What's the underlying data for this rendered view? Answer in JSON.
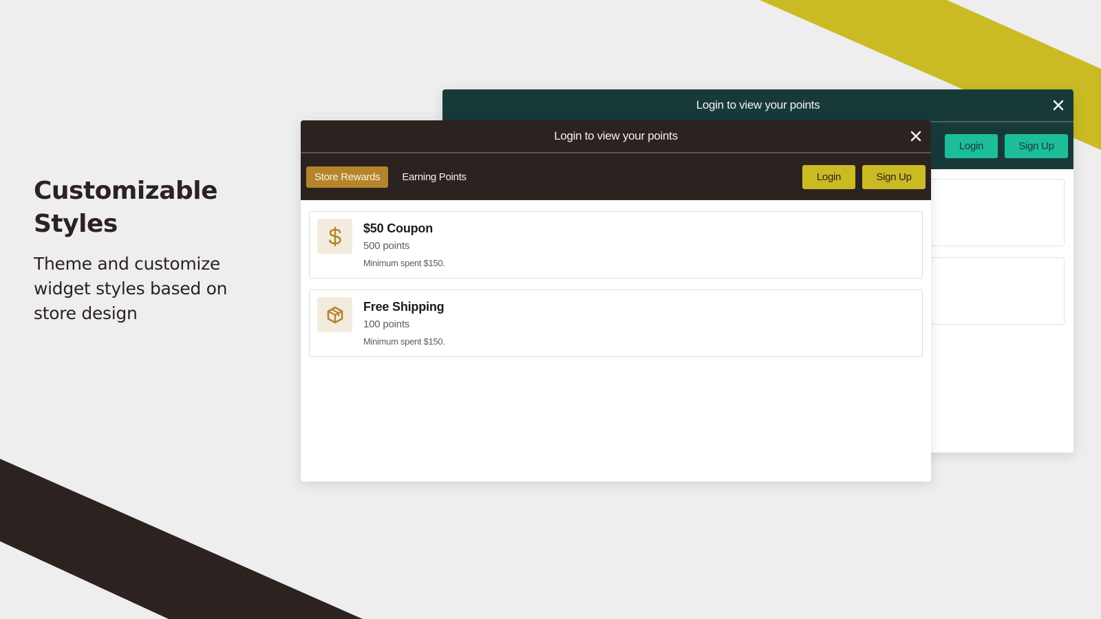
{
  "intro": {
    "title": "Customizable Styles",
    "description": "Theme and customize widget styles based on store design"
  },
  "theme_colors": {
    "background": "#eeeeee",
    "accent_yellow": "#cabb24",
    "dark_brown": "#2c2220",
    "teal_dark": "#173a38",
    "teal_button": "#1dbd9a",
    "gold_tab": "#b4852a",
    "icon_bg": "#f4ebdf"
  },
  "widget_back": {
    "header_title": "Login to view your points",
    "close_icon": "close-icon",
    "buttons": {
      "login": "Login",
      "signup": "Sign Up"
    }
  },
  "widget_front": {
    "header_title": "Login to view your points",
    "close_icon": "close-icon",
    "tabs": [
      {
        "label": "Store Rewards",
        "active": true
      },
      {
        "label": "Earning Points",
        "active": false
      }
    ],
    "buttons": {
      "login": "Login",
      "signup": "Sign Up"
    },
    "rewards": [
      {
        "icon": "dollar-icon",
        "title": "$50 Coupon",
        "points": "500 points",
        "note": "Minimum spent $150."
      },
      {
        "icon": "package-icon",
        "title": "Free Shipping",
        "points": "100 points",
        "note": "Minimum spent $150."
      }
    ]
  }
}
